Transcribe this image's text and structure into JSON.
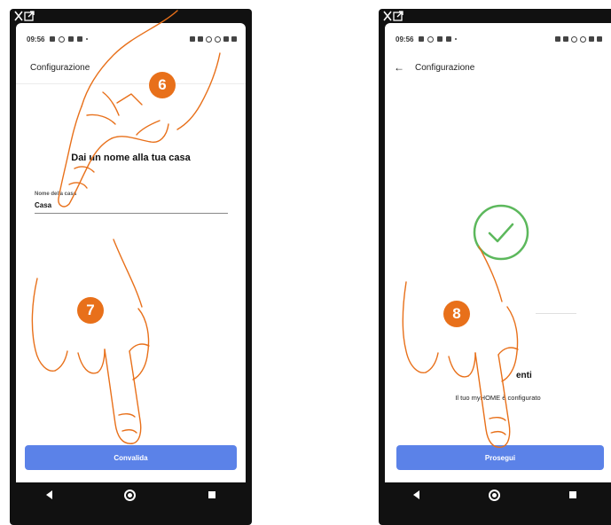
{
  "colors": {
    "accent": "#e8701a",
    "button": "#5b82e8",
    "success": "#5cb85c",
    "phone_frame": "#111111"
  },
  "left_screen": {
    "status_time": "09:56",
    "app_title": "Configurazione",
    "heading": "Dai un nome alla tua casa",
    "field_label": "Nome della casa",
    "field_value": "Casa",
    "button_label": "Convalida"
  },
  "right_screen": {
    "status_time": "09:56",
    "app_title": "Configurazione",
    "success_title": "enti",
    "success_text": "Il tuo myHOME è configurato",
    "button_label": "Prosegui"
  },
  "steps": [
    "6",
    "7",
    "8"
  ],
  "icons": {
    "top_left": "close-expand-icon",
    "back": "arrow-left-icon",
    "success": "checkmark-circle-icon",
    "nav": [
      "back-triangle-icon",
      "home-circle-icon",
      "recent-square-icon"
    ]
  }
}
